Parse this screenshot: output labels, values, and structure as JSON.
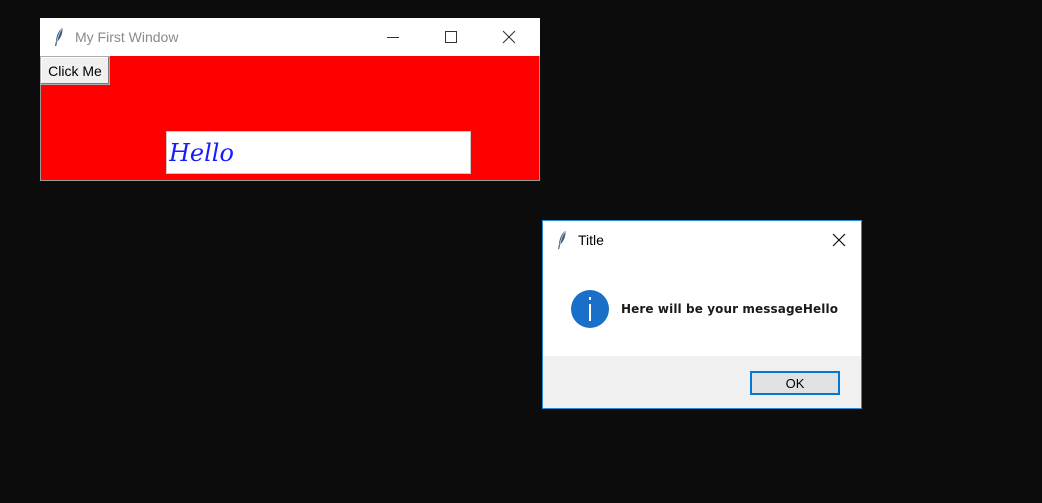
{
  "main_window": {
    "title": "My First Window",
    "background_color": "#ff0000",
    "icon": "feather-icon",
    "controls": {
      "minimize_icon": "minimize-icon",
      "maximize_icon": "maximize-icon",
      "close_icon": "close-icon"
    },
    "click_button_label": "Click Me",
    "entry_value": "Hello",
    "entry_text_color": "#1a1aff"
  },
  "message_box": {
    "title": "Title",
    "icon": "feather-icon",
    "info_icon": "info-icon",
    "message": "Here will be your messageHello",
    "ok_label": "OK",
    "accent_color": "#0078d7"
  }
}
